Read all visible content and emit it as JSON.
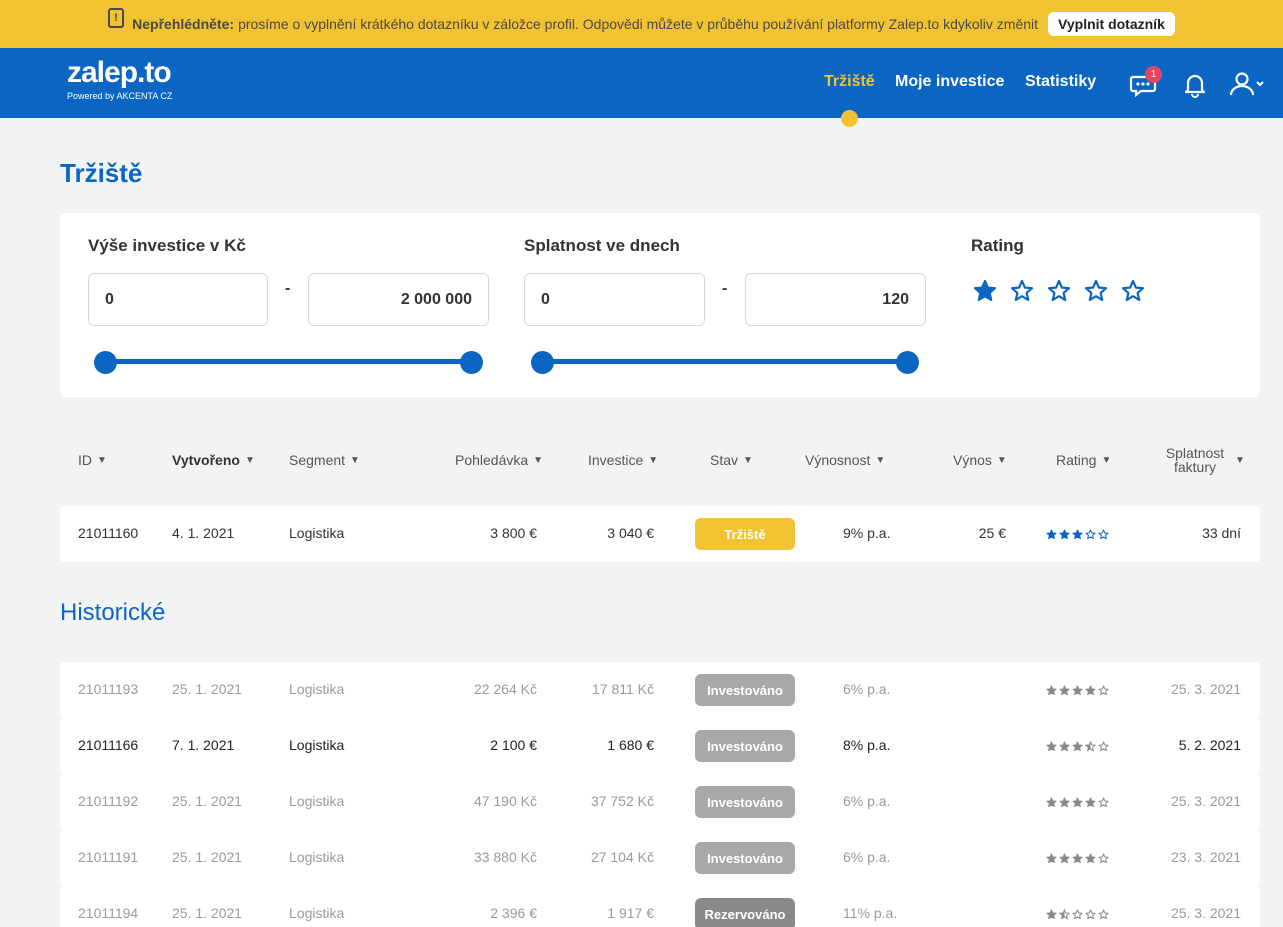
{
  "notice": {
    "bold": "Nepřehlédněte:",
    "text": "prosíme o vyplnění krátkého dotazníku v záložce profil. Odpovědi můžete v průběhu používání platformy Zalep.to kdykoliv změnit",
    "cta": "Vyplnit dotazník"
  },
  "header": {
    "logo": "zalep.to",
    "powered": "Powered by AKCENTA CZ",
    "nav": [
      "Tržiště",
      "Moje investice",
      "Statistiky"
    ],
    "chat_badge": "1"
  },
  "page": {
    "title": "Tržiště"
  },
  "filters": {
    "investment": {
      "label": "Výše investice v Kč",
      "min": "0",
      "max": "2 000 000",
      "dash": "-"
    },
    "maturity": {
      "label": "Splatnost ve dnech",
      "min": "0",
      "max": "120",
      "dash": "-"
    },
    "rating": {
      "label": "Rating",
      "selected": 1,
      "total": 5
    }
  },
  "table": {
    "headers": [
      "ID",
      "Vytvořeno",
      "Segment",
      "Pohledávka",
      "Investice",
      "Stav",
      "Výnosnost",
      "Výnos",
      "Rating",
      "Splatnost faktury"
    ],
    "active_rows": [
      {
        "id": "21011160",
        "created": "4. 1. 2021",
        "segment": "Logistika",
        "claim": "3 800 €",
        "investment": "3 040 €",
        "status": "Tržiště",
        "yield": "9% p.a.",
        "return": "25 €",
        "rating": 3,
        "maturity": "33 dní"
      }
    ],
    "historic_title": "Historické",
    "historic_rows": [
      {
        "id": "21011193",
        "created": "25. 1. 2021",
        "segment": "Logistika",
        "claim": "22 264 Kč",
        "investment": "17 811 Kč",
        "status": "Investováno",
        "yield": "6% p.a.",
        "return": "",
        "rating": 4,
        "maturity": "25. 3. 2021"
      },
      {
        "id": "21011166",
        "created": "7. 1. 2021",
        "segment": "Logistika",
        "claim": "2 100 €",
        "investment": "1 680 €",
        "status": "Investováno",
        "yield": "8% p.a.",
        "return": "",
        "rating": 3.5,
        "maturity": "5. 2. 2021"
      },
      {
        "id": "21011192",
        "created": "25. 1. 2021",
        "segment": "Logistika",
        "claim": "47 190 Kč",
        "investment": "37 752 Kč",
        "status": "Investováno",
        "yield": "6% p.a.",
        "return": "",
        "rating": 4,
        "maturity": "25. 3. 2021"
      },
      {
        "id": "21011191",
        "created": "25. 1. 2021",
        "segment": "Logistika",
        "claim": "33 880 Kč",
        "investment": "27 104 Kč",
        "status": "Investováno",
        "yield": "6% p.a.",
        "return": "",
        "rating": 4,
        "maturity": "23. 3. 2021"
      },
      {
        "id": "21011194",
        "created": "25. 1. 2021",
        "segment": "Logistika",
        "claim": "2 396 €",
        "investment": "1 917 €",
        "status": "Rezervováno",
        "yield": "11% p.a.",
        "return": "",
        "rating": 1.5,
        "maturity": "25. 3. 2021"
      }
    ]
  },
  "colors": {
    "brand_blue": "#0a66c2",
    "accent_yellow": "#f1c232",
    "status_gray": "#a8a8a8",
    "status_dark": "#8a8a8a"
  }
}
